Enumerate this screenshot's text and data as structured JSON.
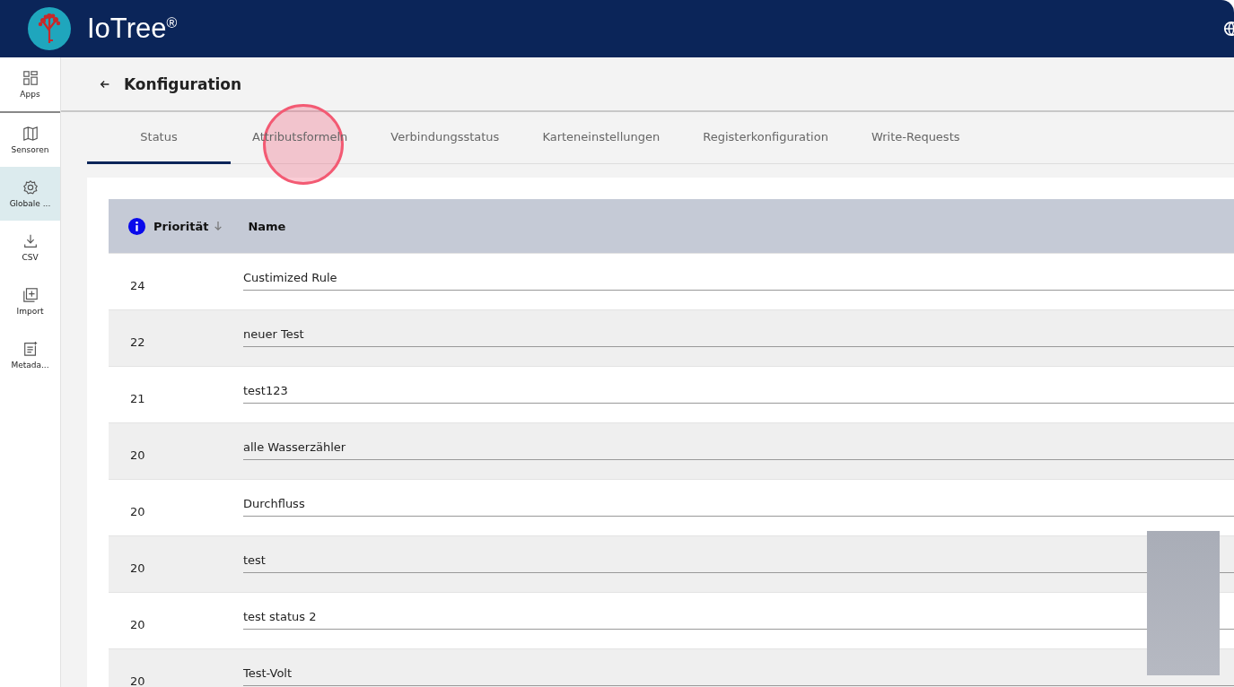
{
  "app": {
    "name": "IoTree",
    "mark": "®"
  },
  "sidebar": {
    "items": [
      {
        "label": "Apps",
        "selected": false
      },
      {
        "label": "Sensoren",
        "selected": false
      },
      {
        "label": "Globale ...",
        "selected": true
      },
      {
        "label": "CSV",
        "selected": false
      },
      {
        "label": "Import",
        "selected": false
      },
      {
        "label": "Metada...",
        "selected": false
      }
    ]
  },
  "page": {
    "title": "Konfiguration"
  },
  "tabs": [
    {
      "label": "Status",
      "selected": true
    },
    {
      "label": "Attributsformeln",
      "selected": false
    },
    {
      "label": "Verbindungsstatus",
      "selected": false
    },
    {
      "label": "Karteneinstellungen",
      "selected": false
    },
    {
      "label": "Registerkonfiguration",
      "selected": false
    },
    {
      "label": "Write-Requests",
      "selected": false
    }
  ],
  "table": {
    "columns": [
      "Priorität",
      "Name"
    ],
    "rows": [
      {
        "priority": "24",
        "name": "Custimized Rule"
      },
      {
        "priority": "22",
        "name": "neuer Test"
      },
      {
        "priority": "21",
        "name": "test123"
      },
      {
        "priority": "20",
        "name": "alle Wasserzähler"
      },
      {
        "priority": "20",
        "name": "Durchfluss"
      },
      {
        "priority": "20",
        "name": "test"
      },
      {
        "priority": "20",
        "name": "test status 2"
      },
      {
        "priority": "20",
        "name": "Test-Volt"
      }
    ]
  }
}
